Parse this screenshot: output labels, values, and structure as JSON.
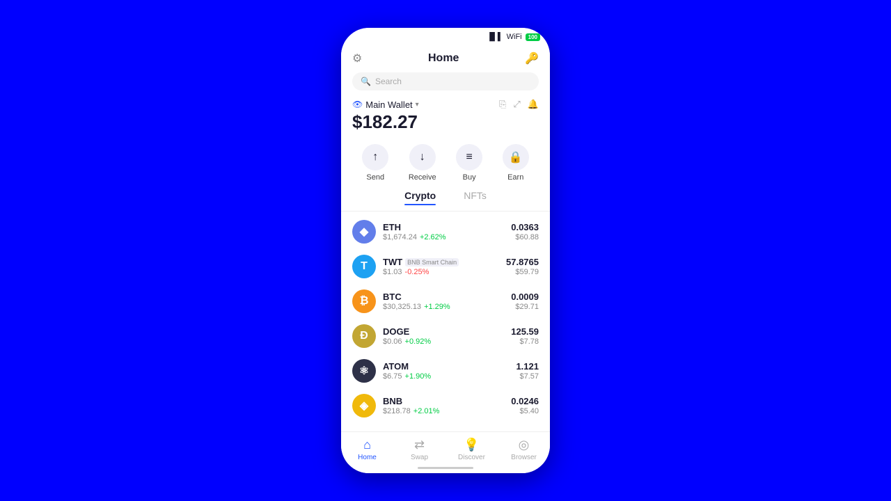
{
  "statusBar": {
    "battery": "100"
  },
  "header": {
    "title": "Home",
    "gearIcon": "⚙",
    "lockIcon": "🔓"
  },
  "search": {
    "placeholder": "Search"
  },
  "wallet": {
    "name": "Main Wallet",
    "balance": "$182.27",
    "eyeIcon": "👁",
    "chevron": "▾"
  },
  "actions": [
    {
      "id": "send",
      "label": "Send",
      "icon": "↑"
    },
    {
      "id": "receive",
      "label": "Receive",
      "icon": "↓"
    },
    {
      "id": "buy",
      "label": "Buy",
      "icon": "▬"
    },
    {
      "id": "earn",
      "label": "Earn",
      "icon": "🔒"
    }
  ],
  "tabs": [
    {
      "id": "crypto",
      "label": "Crypto",
      "active": true
    },
    {
      "id": "nfts",
      "label": "NFTs",
      "active": false
    }
  ],
  "cryptoList": [
    {
      "symbol": "ETH",
      "name": "ETH",
      "network": "",
      "price": "$1,674.24",
      "change": "+2.62%",
      "changeType": "positive",
      "amount": "0.0363",
      "usdValue": "$60.88",
      "iconBg": "#627eea",
      "iconText": "◆",
      "iconColor": "white"
    },
    {
      "symbol": "TWT",
      "name": "TWT",
      "network": "BNB Smart Chain",
      "price": "$1.03",
      "change": "-0.25%",
      "changeType": "negative",
      "amount": "57.8765",
      "usdValue": "$59.79",
      "iconBg": "#1da1f2",
      "iconText": "T",
      "iconColor": "white"
    },
    {
      "symbol": "BTC",
      "name": "BTC",
      "network": "",
      "price": "$30,325.13",
      "change": "+1.29%",
      "changeType": "positive",
      "amount": "0.0009",
      "usdValue": "$29.71",
      "iconBg": "#f7931a",
      "iconText": "₿",
      "iconColor": "white"
    },
    {
      "symbol": "DOGE",
      "name": "DOGE",
      "network": "",
      "price": "$0.06",
      "change": "+0.92%",
      "changeType": "positive",
      "amount": "125.59",
      "usdValue": "$7.78",
      "iconBg": "#c2a633",
      "iconText": "Ð",
      "iconColor": "white"
    },
    {
      "symbol": "ATOM",
      "name": "ATOM",
      "network": "",
      "price": "$6.75",
      "change": "+1.90%",
      "changeType": "positive",
      "amount": "1.121",
      "usdValue": "$7.57",
      "iconBg": "#2e3148",
      "iconText": "⚛",
      "iconColor": "white"
    },
    {
      "symbol": "BNB",
      "name": "BNB",
      "network": "",
      "price": "$218.78",
      "change": "+2.01%",
      "changeType": "positive",
      "amount": "0.0246",
      "usdValue": "$5.40",
      "iconBg": "#f0b90b",
      "iconText": "◈",
      "iconColor": "white"
    }
  ],
  "bottomNav": [
    {
      "id": "home",
      "label": "Home",
      "icon": "⌂",
      "active": true
    },
    {
      "id": "swap",
      "label": "Swap",
      "icon": "⇄",
      "active": false
    },
    {
      "id": "discover",
      "label": "Discover",
      "icon": "💡",
      "active": false
    },
    {
      "id": "browser",
      "label": "Browser",
      "icon": "◎",
      "active": false
    }
  ]
}
